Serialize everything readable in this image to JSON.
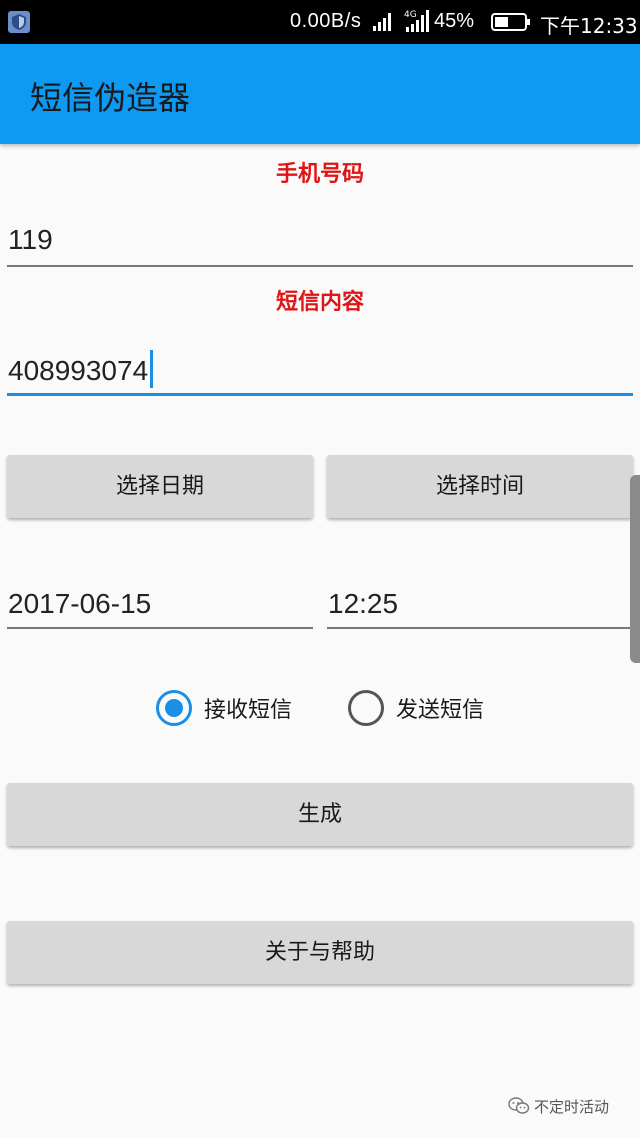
{
  "status_bar": {
    "network_speed": "0.00B/s",
    "signal_label": "4G",
    "battery_percent": "45%",
    "time": "下午12:33",
    "battery_level": 0.45
  },
  "app_bar": {
    "title": "短信伪造器"
  },
  "form": {
    "phone_label": "手机号码",
    "phone_value": "119",
    "content_label": "短信内容",
    "content_value": "408993074",
    "select_date_button": "选择日期",
    "select_time_button": "选择时间",
    "date_value": "2017-06-15",
    "time_value": "12:25",
    "radio_receive": "接收短信",
    "radio_send": "发送短信",
    "selected_radio": "receive",
    "generate_button": "生成",
    "about_button": "关于与帮助"
  },
  "watermark": {
    "text": "不定时活动"
  },
  "colors": {
    "app_bar": "#0e99f3",
    "label_red": "#e01414",
    "accent": "#1b8fe4",
    "button": "#d8d8d8"
  }
}
